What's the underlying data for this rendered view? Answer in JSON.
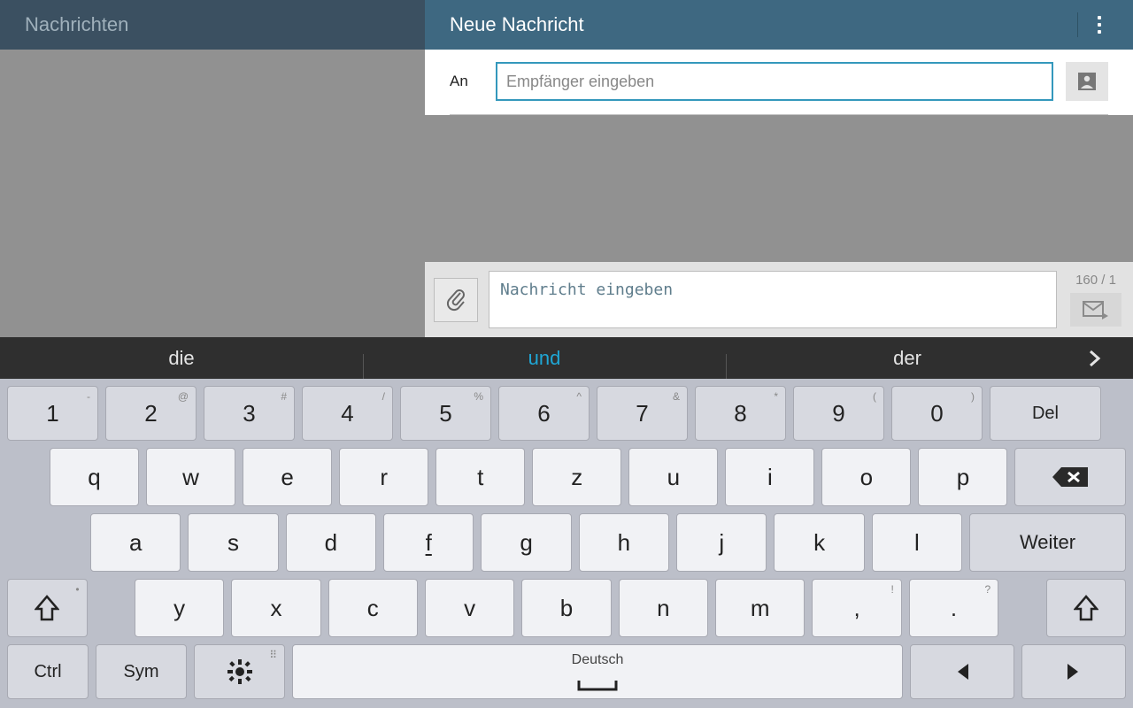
{
  "header": {
    "left_title": "Nachrichten",
    "right_title": "Neue Nachricht"
  },
  "recipient": {
    "label": "An",
    "placeholder": "Empfänger eingeben",
    "value": ""
  },
  "compose": {
    "placeholder": "Nachricht eingeben",
    "value": "",
    "counter": "160 / 1"
  },
  "suggestions": {
    "items": [
      "die",
      "und",
      "der"
    ],
    "active_index": 1
  },
  "keyboard": {
    "row1": [
      {
        "main": "1",
        "sup": "-"
      },
      {
        "main": "2",
        "sup": "@"
      },
      {
        "main": "3",
        "sup": "#"
      },
      {
        "main": "4",
        "sup": "/"
      },
      {
        "main": "5",
        "sup": "%"
      },
      {
        "main": "6",
        "sup": "^"
      },
      {
        "main": "7",
        "sup": "&"
      },
      {
        "main": "8",
        "sup": "*"
      },
      {
        "main": "9",
        "sup": "("
      },
      {
        "main": "0",
        "sup": ")"
      }
    ],
    "del_label": "Del",
    "row2": [
      "q",
      "w",
      "e",
      "r",
      "t",
      "z",
      "u",
      "i",
      "o",
      "p"
    ],
    "row3": [
      "a",
      "s",
      "d",
      "f",
      "g",
      "h",
      "j",
      "k",
      "l"
    ],
    "enter_label": "Weiter",
    "row4": [
      "y",
      "x",
      "c",
      "v",
      "b",
      "n",
      "m"
    ],
    "punct": [
      {
        "main": ",",
        "sup": "!"
      },
      {
        "main": ".",
        "sup": "?"
      }
    ],
    "ctrl_label": "Ctrl",
    "sym_label": "Sym",
    "space_label": "Deutsch"
  }
}
